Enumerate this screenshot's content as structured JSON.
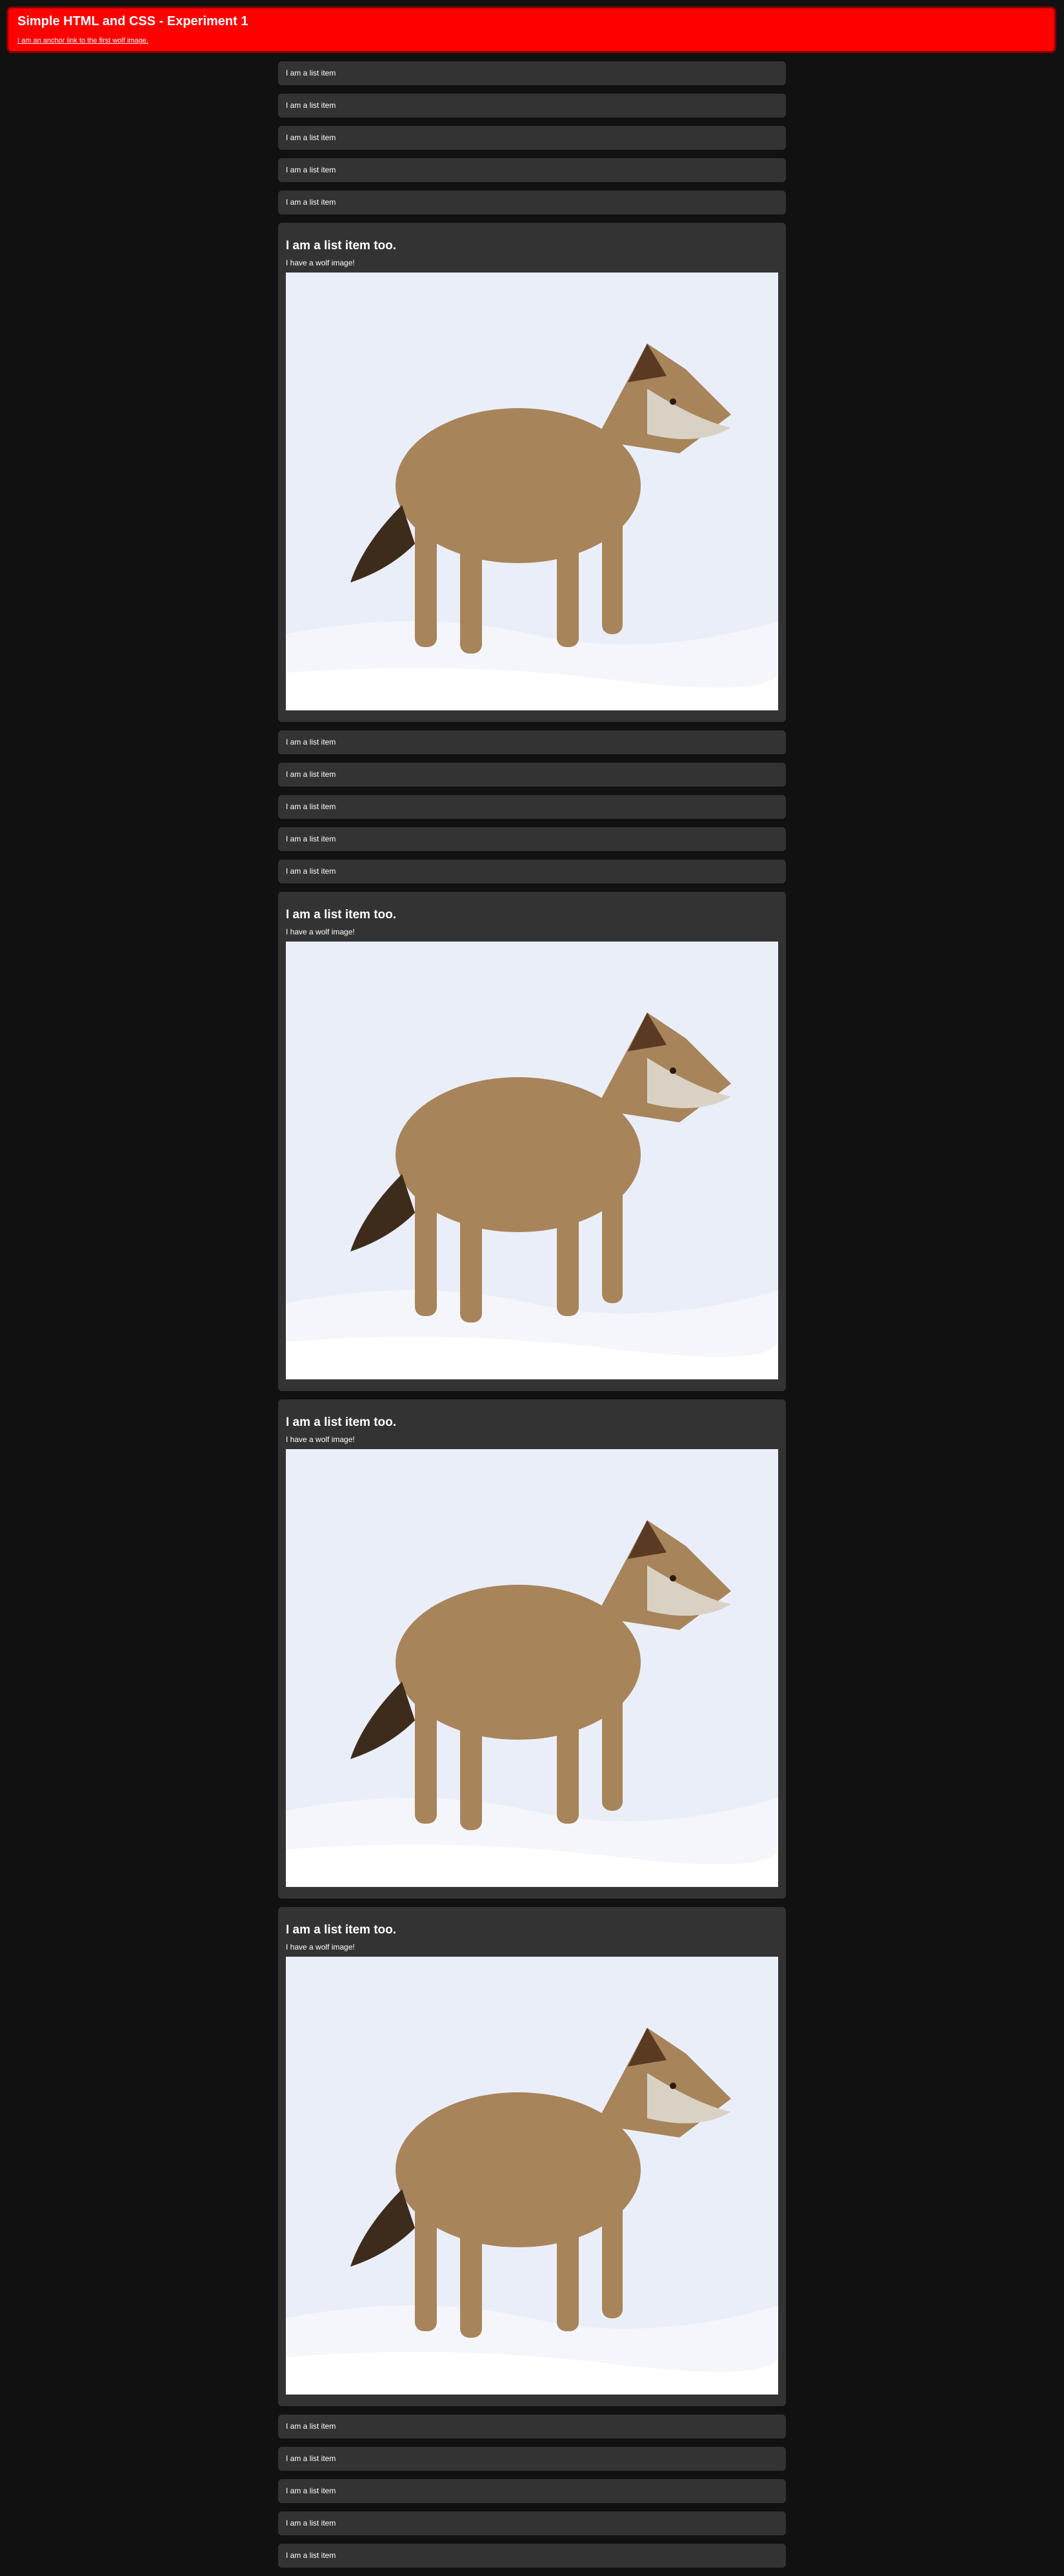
{
  "header": {
    "title": "Simple HTML and CSS - Experiment 1",
    "link": "I am an anchor link to the first wolf image."
  },
  "list": {
    "simple_label": "I am a list item",
    "wolf_title": "I am a list item too.",
    "wolf_caption": "I have a wolf image!"
  },
  "colors": {
    "page_background": "#111111",
    "header_background": "#ff0000",
    "item_background": "#333333"
  }
}
